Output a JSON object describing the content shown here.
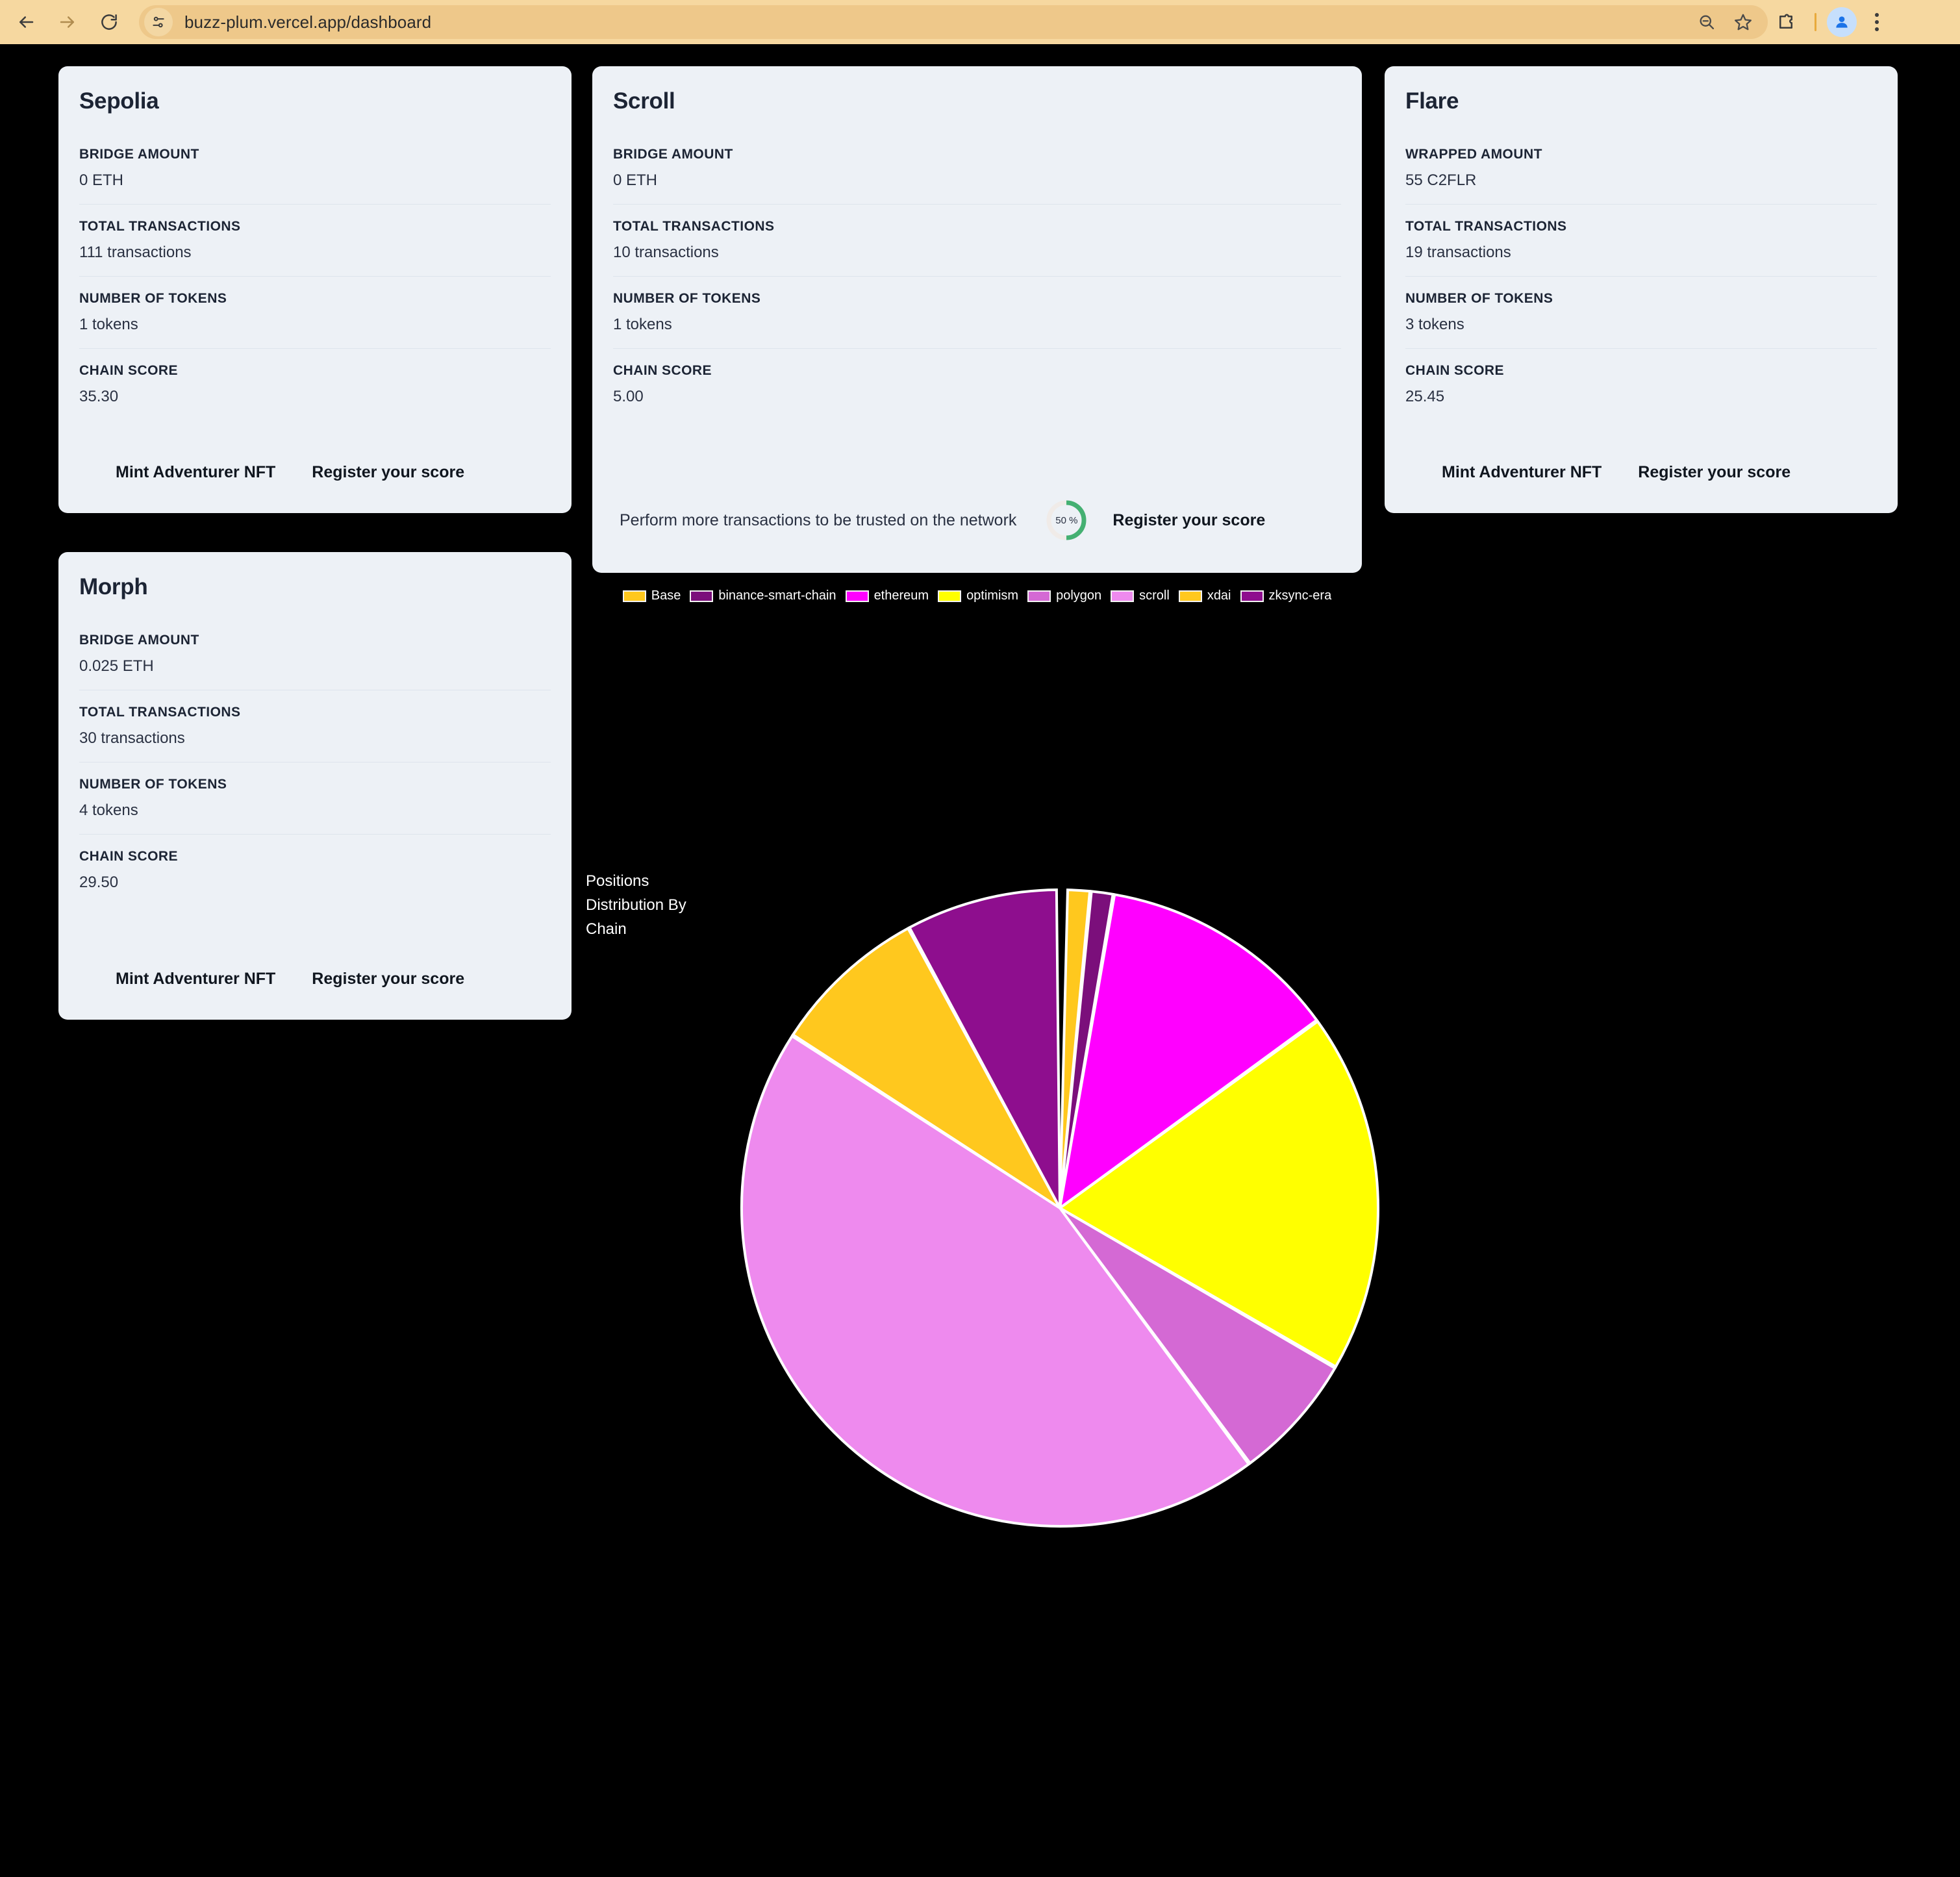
{
  "browser": {
    "url": "buzz-plum.vercel.app/dashboard",
    "back_label": "Back",
    "forward_label": "Forward",
    "reload_label": "Reload",
    "site_info_label": "View site information",
    "zoom_label": "Zoom out",
    "bookmark_label": "Bookmark this tab",
    "extensions_label": "Extensions",
    "profile_label": "Profile",
    "menu_label": "Customize and control Chrome",
    "toolbar_bg": "#f6d8a0",
    "omnibox_bg": "#eec88a"
  },
  "cards": [
    {
      "id": "sepolia",
      "title": "Sepolia",
      "stats": [
        {
          "label": "BRIDGE AMOUNT",
          "value": "0 ETH"
        },
        {
          "label": "TOTAL TRANSACTIONS",
          "value": "111 transactions"
        },
        {
          "label": "NUMBER OF TOKENS",
          "value": "1 tokens"
        },
        {
          "label": "CHAIN SCORE",
          "value": "35.30"
        }
      ],
      "mint_label": "Mint Adventurer NFT",
      "register_label": "Register your score"
    },
    {
      "id": "scroll",
      "title": "Scroll",
      "stats": [
        {
          "label": "BRIDGE AMOUNT",
          "value": "0 ETH"
        },
        {
          "label": "TOTAL TRANSACTIONS",
          "value": "10 transactions"
        },
        {
          "label": "NUMBER OF TOKENS",
          "value": "1 tokens"
        },
        {
          "label": "CHAIN SCORE",
          "value": "5.00"
        }
      ],
      "hint": "Perform more transactions to be trusted on the network",
      "gauge_value": "50 %",
      "gauge_percent": 50,
      "gauge_color": "#44b072",
      "gauge_track_color": "#f0ebe8",
      "register_label": "Register your score"
    },
    {
      "id": "flare",
      "title": "Flare",
      "stats": [
        {
          "label": "WRAPPED AMOUNT",
          "value": "55 C2FLR"
        },
        {
          "label": "TOTAL TRANSACTIONS",
          "value": "19 transactions"
        },
        {
          "label": "NUMBER OF TOKENS",
          "value": "3 tokens"
        },
        {
          "label": "CHAIN SCORE",
          "value": "25.45"
        }
      ],
      "mint_label": "Mint Adventurer NFT",
      "register_label": "Register your score"
    },
    {
      "id": "morph",
      "title": "Morph",
      "stats": [
        {
          "label": "BRIDGE AMOUNT",
          "value": "0.025 ETH"
        },
        {
          "label": "TOTAL TRANSACTIONS",
          "value": "30 transactions"
        },
        {
          "label": "NUMBER OF TOKENS",
          "value": "4 tokens"
        },
        {
          "label": "CHAIN SCORE",
          "value": "29.50"
        }
      ],
      "mint_label": "Mint Adventurer NFT",
      "register_label": "Register your score"
    }
  ],
  "chart_data": {
    "type": "pie",
    "title": "Positions Distribution By Chain",
    "legend_position": "top",
    "start_angle_deg": 0,
    "direction": "clockwise",
    "categories": [
      "Base",
      "binance-smart-chain",
      "ethereum",
      "optimism",
      "polygon",
      "scroll",
      "xdai",
      "zksync-era"
    ],
    "colors": [
      "#FFC81E",
      "#7B0F7B",
      "#FF00FF",
      "#FFFF00",
      "#D469D4",
      "#EE8AEE",
      "#FFC81E",
      "#8E0E8E"
    ],
    "slices": [
      {
        "label": "Base",
        "color": "#FFC81E",
        "percent": 1.1,
        "start_deg": 1.4,
        "end_deg": 5.4
      },
      {
        "label": "binance-smart-chain",
        "color": "#7B0F7B",
        "percent": 1.1,
        "start_deg": 5.7,
        "end_deg": 9.6
      },
      {
        "label": "ethereum",
        "color": "#FF00FF",
        "percent": 12.2,
        "start_deg": 9.9,
        "end_deg": 53.8
      },
      {
        "label": "optimism",
        "color": "#FFFF00",
        "percent": 18.3,
        "start_deg": 54.1,
        "end_deg": 119.9
      },
      {
        "label": "polygon",
        "color": "#D469D4",
        "percent": 6.4,
        "start_deg": 120.2,
        "end_deg": 143.3
      },
      {
        "label": "scroll",
        "color": "#EE8AEE",
        "percent": 44.2,
        "start_deg": 143.6,
        "end_deg": 302.7
      },
      {
        "label": "xdai",
        "color": "#FFC81E",
        "percent": 7.9,
        "start_deg": 303.0,
        "end_deg": 331.5
      },
      {
        "label": "zksync-era",
        "color": "#8E0E8E",
        "percent": 8.8,
        "start_deg": 331.8,
        "end_deg": 359.4
      }
    ],
    "values": [
      1.1,
      1.1,
      12.2,
      18.3,
      6.4,
      44.2,
      7.9,
      8.8
    ],
    "background": "#000000",
    "slice_border_color": "#ffffff"
  }
}
